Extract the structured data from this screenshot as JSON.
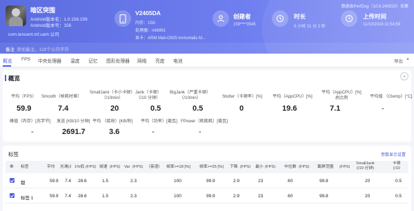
{
  "top_link": "数据由PerfDog（10.6.240920）采集",
  "app": {
    "name": "暗区突围",
    "version_name": "Android版本名：1.0.156.156",
    "version_code": "Android版本号：156",
    "package": "com.tencent.mf.uam 公司"
  },
  "device": {
    "model": "V2405DA",
    "memory": "内存：15G",
    "cpu": "处理器：mt6991",
    "gpu": "显卡：ARM Mali-G925-Immortalis M..."
  },
  "creator": {
    "title": "创建者",
    "value": "159****3545"
  },
  "duration": {
    "title": "时长",
    "value": "0 小时 21 分 2 秒"
  },
  "upload": {
    "title": "上传时间",
    "value": "11/10/2024 11:54:59"
  },
  "remark": {
    "label": "备注",
    "placeholder": "添加备注，128个以内字符"
  },
  "tabs": [
    "概览",
    "FPS",
    "中央处理器",
    "温度",
    "记忆",
    "图形处理器",
    "网络",
    "亮度",
    "电池"
  ],
  "export_label": "导出",
  "overview": {
    "title": "概览",
    "metrics_row1": [
      {
        "label": "平均（FPS）",
        "value": "59.9"
      },
      {
        "label": "Smooth（帧耗时差）",
        "value": "7.4"
      },
      {
        "label": "SmallJank（卡小卡顿）\n（/10min）",
        "value": "20"
      },
      {
        "label": "Jank（卡顿）\n（/10 分钟）",
        "value": "0.5"
      },
      {
        "label": "BigJank（严重卡顿）\n（/10min）",
        "value": "0.5"
      },
      {
        "label": "Stutter（卡顿率）[%]",
        "value": "0"
      },
      {
        "label": "平均（AppCPU）[%]",
        "value": "19.6"
      },
      {
        "label": "平均（AppCPU）[%]\n总比例",
        "value": "7.1"
      },
      {
        "label": "平均值 （Ctemp）[°C]",
        "value": "-"
      }
    ],
    "metrics_row2": [
      {
        "label": "峰值（内存）[兆字节]",
        "value": "-"
      },
      {
        "label": "发送 [KB/10 分钟]",
        "value": "2691.7"
      },
      {
        "label": "平均 （接收）[KB/秒]",
        "value": "3.6"
      },
      {
        "label": "平均（功率）[毫瓦]",
        "value": "-"
      },
      {
        "label": "FPower（耗能耗）[毫瓦]",
        "value": "-"
      }
    ]
  },
  "tags": {
    "title": "标签",
    "settings_link": "参数显示设置",
    "columns": [
      "标签",
      "平均",
      "光滑(ｽ",
      "1%低",
      "(FPS)",
      "帧速",
      "(FPS)",
      "Var",
      "(FPS)",
      "（英语）",
      "帧率>=18 [%]",
      "帧率>=25 [%]",
      "下降",
      "(FPS)",
      "最小",
      "(FPS)",
      "中位数",
      "(FPS)",
      "截屏范围",
      "(FPS)",
      "SmallJank\n(/10 分钟)",
      "卡顿\n(/10"
    ],
    "rows": [
      {
        "name": "都",
        "values": [
          "59.9",
          "7.4",
          "28.6",
          "1.5",
          "2.3",
          "100",
          "99.9",
          "2.9",
          "23",
          "60",
          "99.8",
          "20",
          "0.5"
        ]
      },
      {
        "name": "标签 1",
        "values": [
          "59.9",
          "7.4",
          "28.6",
          "1.5",
          "2.3",
          "100",
          "99.9",
          "2.9",
          "23",
          "60",
          "99.8",
          "20",
          "0.5"
        ]
      }
    ]
  }
}
